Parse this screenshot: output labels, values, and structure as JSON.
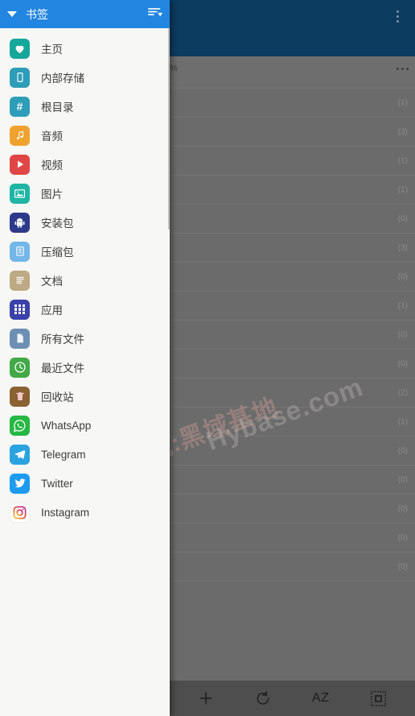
{
  "background_app": {
    "appbar": {
      "color": "#0d3c61",
      "overflow_menu_icon": "more-vert-icon"
    },
    "toolbar": {
      "color": "#6e6e6e",
      "partial_label": "%",
      "overflow_menu_icon": "more-horiz-icon"
    },
    "list": {
      "counts": [
        "(1)",
        "(3)",
        "(1)",
        "(1)",
        "(0)",
        "(3)",
        "(0)",
        "(1)",
        "(0)",
        "(0)",
        "(2)",
        "(1)",
        "(0)",
        "(0)",
        "(0)",
        "(0)",
        "(0)"
      ]
    },
    "bottom_bar": {
      "buttons": [
        {
          "name": "add-button",
          "icon": "plus-icon",
          "label": ""
        },
        {
          "name": "refresh-button",
          "icon": "refresh-icon",
          "label": ""
        },
        {
          "name": "sort-az-button",
          "icon": "az-text-icon",
          "label": "AZ"
        },
        {
          "name": "select-all-button",
          "icon": "select-all-icon",
          "label": ""
        }
      ]
    }
  },
  "drawer": {
    "header": {
      "title": "书签",
      "caret_icon": "chevron-down-icon",
      "sort_icon": "sort-descending-icon",
      "background": "#2286e0"
    },
    "items": [
      {
        "label": "主页",
        "icon": "heart-icon",
        "color": "#16a79b"
      },
      {
        "label": "内部存储",
        "icon": "phone-icon",
        "color": "#2e9db8"
      },
      {
        "label": "根目录",
        "icon": "hash-icon",
        "color": "#2e9db8"
      },
      {
        "label": "音频",
        "icon": "music-note-icon",
        "color": "#f0a22e"
      },
      {
        "label": "视频",
        "icon": "play-icon",
        "color": "#e04646"
      },
      {
        "label": "图片",
        "icon": "image-icon",
        "color": "#1fb5a5"
      },
      {
        "label": "安装包",
        "icon": "android-icon",
        "color": "#2d3a8c"
      },
      {
        "label": "压缩包",
        "icon": "archive-icon",
        "color": "#73b7e8"
      },
      {
        "label": "文档",
        "icon": "document-icon",
        "color": "#bda983"
      },
      {
        "label": "应用",
        "icon": "apps-grid-icon",
        "color": "#3b41a8"
      },
      {
        "label": "所有文件",
        "icon": "file-icon",
        "color": "#6d8fb3"
      },
      {
        "label": "最近文件",
        "icon": "clock-icon",
        "color": "#43a948"
      },
      {
        "label": "回收站",
        "icon": "trash-icon",
        "color": "#8a6232"
      },
      {
        "label": "WhatsApp",
        "icon": "whatsapp-icon",
        "color": "#25b843"
      },
      {
        "label": "Telegram",
        "icon": "telegram-icon",
        "color": "#2aa3e0"
      },
      {
        "label": "Twitter",
        "icon": "twitter-icon",
        "color": "#1d9bf0"
      },
      {
        "label": "Instagram",
        "icon": "instagram-icon",
        "color": "#ffffff"
      }
    ]
  },
  "watermark": {
    "chinese": "记得收藏:黑域基地",
    "english": "Hybase.com"
  }
}
